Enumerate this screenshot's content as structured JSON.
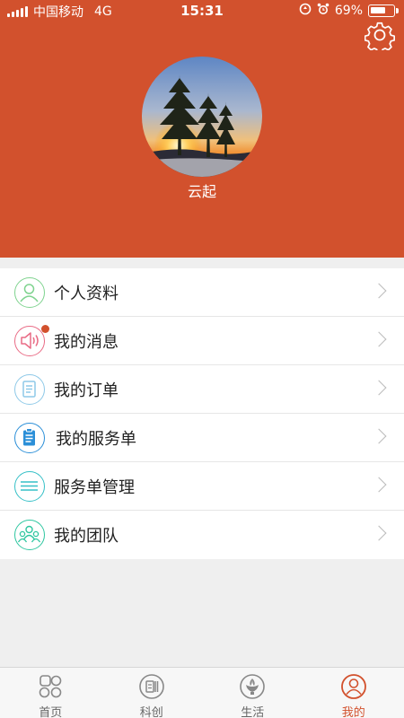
{
  "status": {
    "carrier": "中国移动",
    "network": "4G",
    "time": "15:31",
    "battery": "69%",
    "battery_level": 0.69
  },
  "profile": {
    "name": "云起"
  },
  "menu": {
    "items": [
      {
        "label": "个人资料",
        "icon": "person-icon",
        "color": "#7fd38f"
      },
      {
        "label": "我的消息",
        "icon": "speaker-icon",
        "color": "#e96b85",
        "badge": true
      },
      {
        "label": "我的订单",
        "icon": "document-icon",
        "color": "#8ec9e8"
      },
      {
        "label": "我的服务单",
        "icon": "clipboard-icon",
        "color": "#2b8fd8"
      },
      {
        "label": "服务单管理",
        "icon": "list-icon",
        "color": "#35c0c7"
      },
      {
        "label": "我的团队",
        "icon": "team-icon",
        "color": "#2ec6a0"
      }
    ]
  },
  "tabbar": {
    "tabs": [
      {
        "label": "首页",
        "icon": "home-icon"
      },
      {
        "label": "科创",
        "icon": "innovation-icon"
      },
      {
        "label": "生活",
        "icon": "life-icon"
      },
      {
        "label": "我的",
        "icon": "profile-icon",
        "active": true
      }
    ]
  },
  "colors": {
    "header": "#d2512d",
    "active": "#d2512d"
  }
}
